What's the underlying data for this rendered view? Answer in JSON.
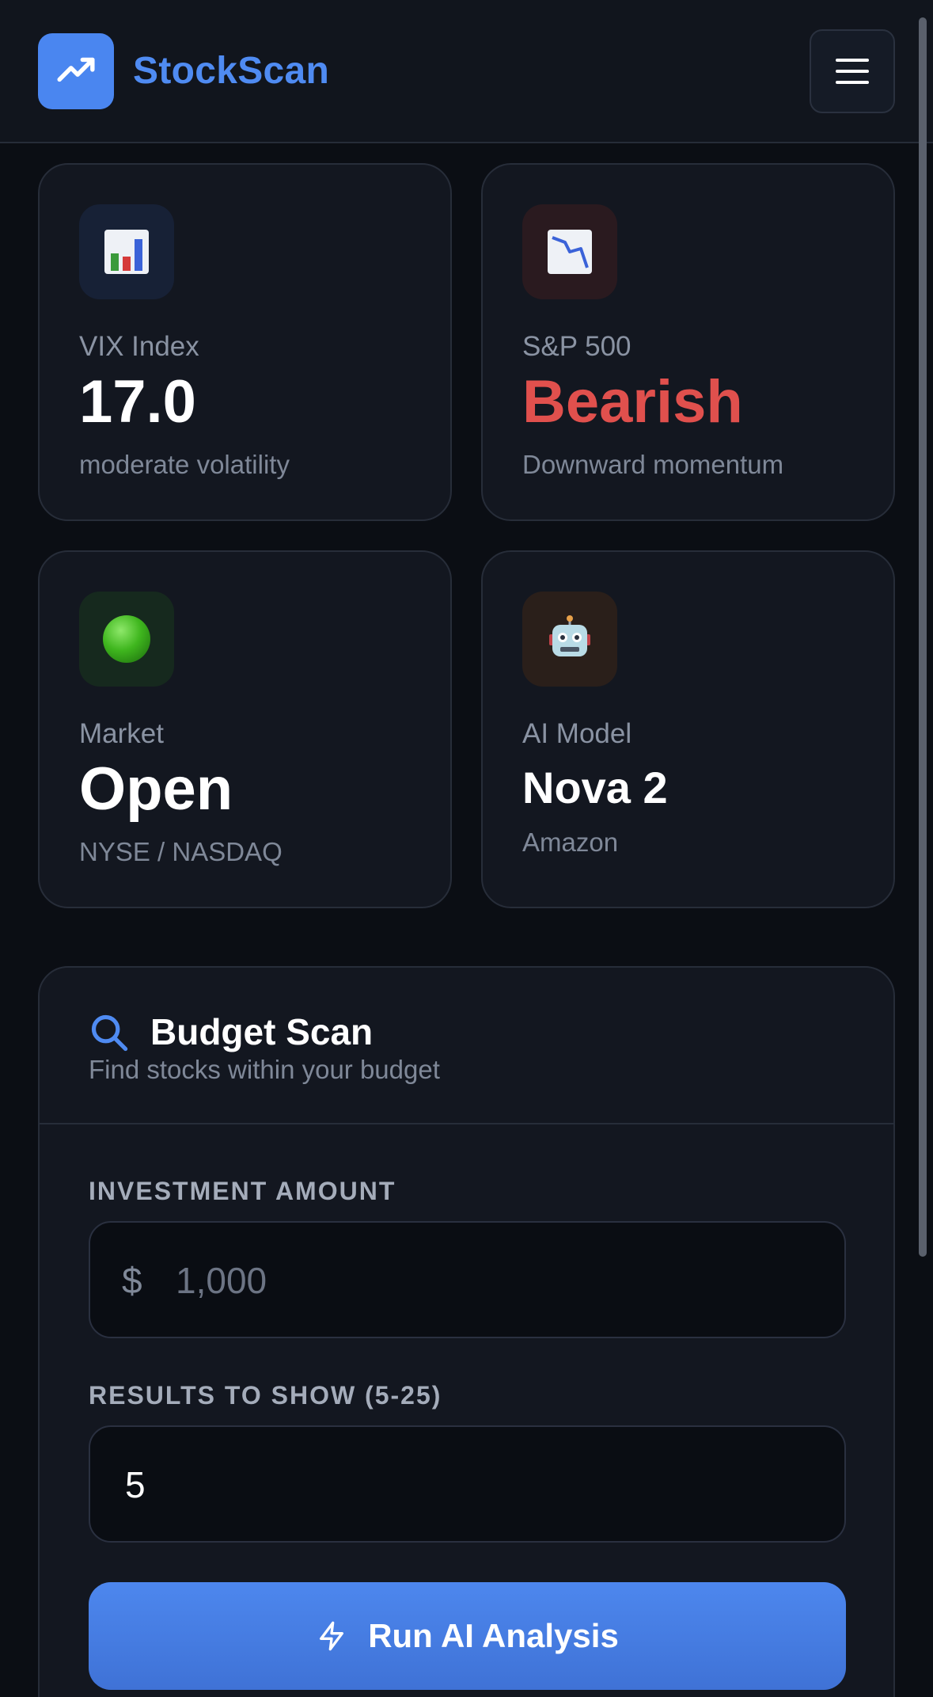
{
  "header": {
    "brand": "StockScan",
    "logo_icon": "trending-up-icon",
    "menu_icon": "hamburger-menu-icon"
  },
  "cards": {
    "vix": {
      "icon": "bar-chart-icon",
      "label": "VIX Index",
      "value": "17.0",
      "sub": "moderate volatility"
    },
    "sp500": {
      "icon": "chart-decreasing-icon",
      "label": "S&P 500",
      "value": "Bearish",
      "sub": "Downward momentum",
      "value_color": "#e0504d"
    },
    "market": {
      "icon": "green-circle-icon",
      "label": "Market",
      "value": "Open",
      "sub": "NYSE / NASDAQ"
    },
    "ai": {
      "icon": "robot-icon",
      "label": "AI Model",
      "value": "Nova 2",
      "sub": "Amazon"
    }
  },
  "budget_scan": {
    "title": "Budget Scan",
    "subtitle": "Find stocks within your budget",
    "investment_label": "INVESTMENT AMOUNT",
    "currency_symbol": "$",
    "investment_placeholder": "1,000",
    "results_label": "RESULTS TO SHOW (5-25)",
    "results_value": "5",
    "run_button": "Run AI Analysis"
  },
  "colors": {
    "accent": "#4f8bf2",
    "bearish": "#e0504d",
    "background": "#0b0e14",
    "card": "#131720"
  }
}
